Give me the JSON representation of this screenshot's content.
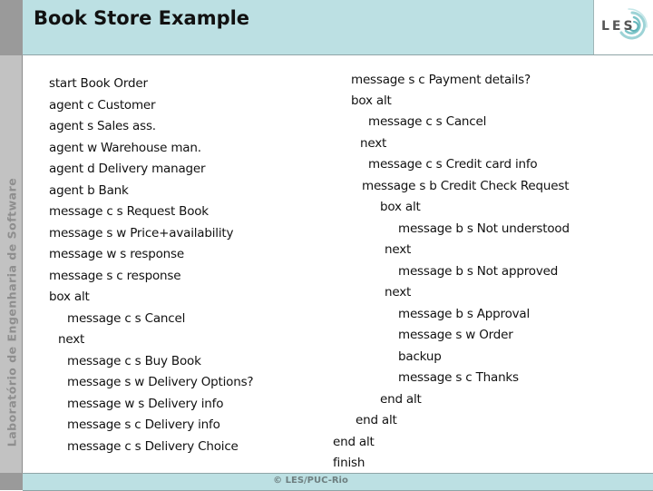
{
  "sidebar": {
    "vertical_label": "Laboratório de Engenharia de Software"
  },
  "header": {
    "title": "Book Store Example",
    "logo_text": "LES",
    "logo_icon": "swirl-icon"
  },
  "left_column": [
    "start Book Order",
    "agent c Customer",
    "agent s Sales ass.",
    "agent w Warehouse man.",
    "agent d Delivery manager",
    "agent b Bank",
    "message c s Request Book",
    "message s w Price+availability",
    "message w s response",
    "message s c response",
    "box alt",
    "message c s Cancel",
    "next",
    "message c s Buy Book",
    "message s w Delivery Options?",
    "message w s Delivery info",
    "message s c Delivery info",
    "message c s Delivery Choice"
  ],
  "right_column": [
    "message s c Payment details?",
    "box alt",
    "message c s Cancel",
    "next",
    "message c s Credit card info",
    "message s b Credit Check Request",
    "box alt",
    "message b s Not understood",
    "next",
    "message b s Not approved",
    "next",
    "message b s Approval",
    "message s w Order",
    "backup",
    "message s c Thanks",
    "end alt",
    "end alt",
    "end alt",
    "finish"
  ],
  "footer": {
    "copyright": "© LES/PUC-Rio"
  }
}
